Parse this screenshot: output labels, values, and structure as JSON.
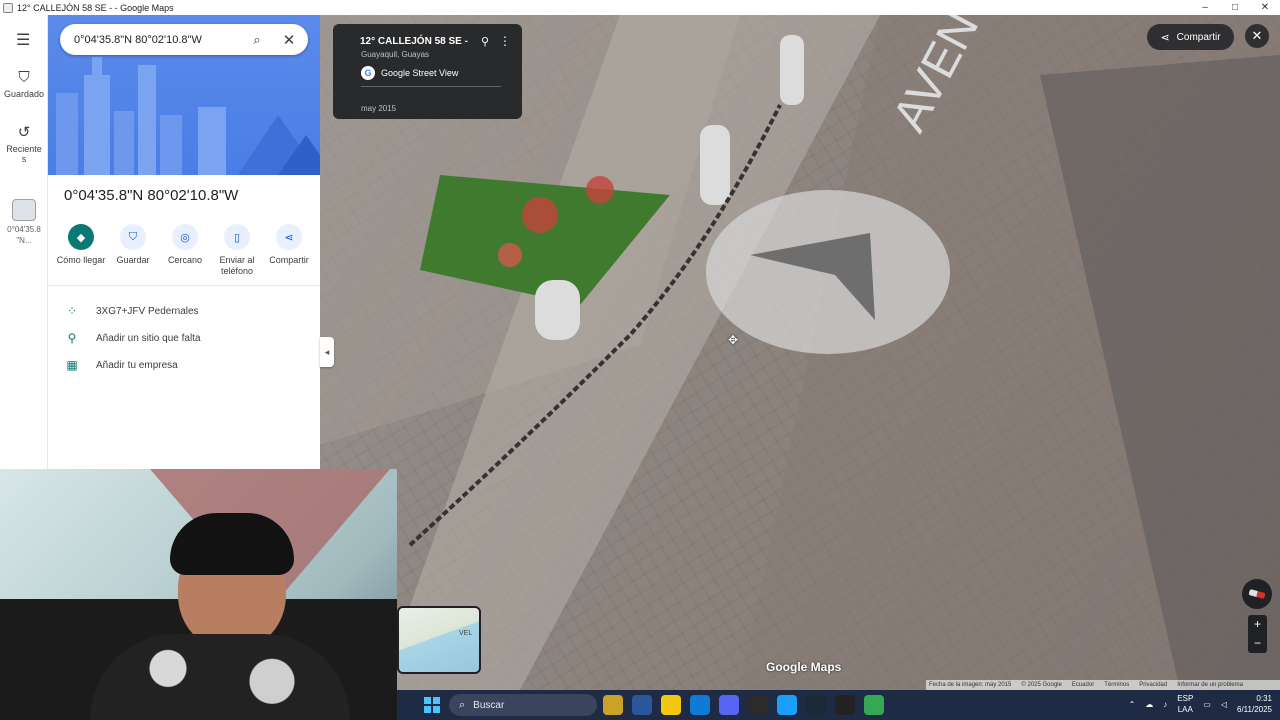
{
  "window": {
    "title": "12° CALLEJÓN 58 SE - - Google Maps",
    "minimize": "–",
    "maximize": "□",
    "close": "✕"
  },
  "rail": {
    "menu_icon": "☰",
    "saved": {
      "icon": "bookmark-icon",
      "label": "Guardado"
    },
    "recent": {
      "icon": "history-icon",
      "label": "Reciente s"
    },
    "recent_line1": "Reciente",
    "recent_line2": "s",
    "thumb_line1": "0°04'35.8",
    "thumb_line2": "\"N..."
  },
  "search": {
    "value": "0°04'35.8\"N 80°02'10.8\"W"
  },
  "place": {
    "title": "0°04'35.8\"N 80°02'10.8\"W"
  },
  "actions": [
    {
      "label": "Cómo llegar",
      "icon": "directions-icon"
    },
    {
      "label": "Guardar",
      "icon": "bookmark-icon"
    },
    {
      "label": "Cercano",
      "icon": "nearby-icon"
    },
    {
      "label": "Enviar al teléfono",
      "icon": "phone-icon"
    },
    {
      "label": "Compartir",
      "icon": "share-icon"
    }
  ],
  "info": {
    "plus_code": "3XG7+JFV Pedernales",
    "add_place": "Añadir un sitio que falta",
    "add_business": "Añadir tu empresa"
  },
  "street_view": {
    "card_title": "12° CALLEJÓN 58 SE -",
    "card_subtitle": "Guayaquil, Guayas",
    "brand": "Google Street View",
    "date": "may 2015",
    "share_label": "Compartir",
    "logo": "Google Maps",
    "footer": {
      "image_date": "Fecha de la imagen: may 2015",
      "copyright": "© 2025 Google",
      "country": "Ecuador",
      "terms": "Términos",
      "privacy": "Privacidad",
      "report": "Informar de un problema"
    },
    "zoom_in": "+",
    "zoom_out": "−"
  },
  "minimap": {
    "label": "VEL"
  },
  "taskbar": {
    "search_placeholder": "Buscar",
    "lang_line1": "ESP",
    "lang_line2": "LAA",
    "time": "0:31",
    "date": "6/11/2025",
    "app_colors": [
      "#c9a227",
      "#2b579a",
      "#f2c811",
      "#0f7bd6",
      "#5865f2",
      "#2b2b2b",
      "#1a9fff",
      "#1b2838",
      "#222222",
      "#34a853"
    ]
  }
}
